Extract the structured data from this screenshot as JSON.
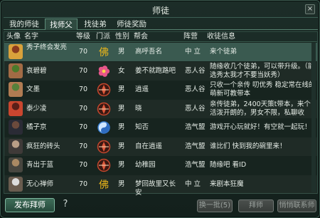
{
  "window": {
    "title": "师徒",
    "close_label": "×"
  },
  "tabs": [
    {
      "label": "我的师徒"
    },
    {
      "label": "找师父"
    },
    {
      "label": "找徒弟"
    },
    {
      "label": "师徒奖励"
    }
  ],
  "active_tab": 1,
  "columns": [
    "头像",
    "名字",
    "等级",
    "门派",
    "性别",
    "帮会",
    "阵营",
    "收徒信息"
  ],
  "rows": [
    {
      "name": "秀子终会发亮",
      "level": "70",
      "sect_icon": "fo-sect-icon",
      "gender": "男",
      "guild": "高呼吾名",
      "faction": "中 立",
      "info": "来个徒弟"
    },
    {
      "name": "哀碧碧",
      "level": "70",
      "sect_icon": "flower-sect-icon",
      "gender": "女",
      "guild": "姜不就跑路吧",
      "faction": "恶人谷",
      "info": "随缘收几个徒弟，可以带升级。（能选秀太我才不要当妖秀）"
    },
    {
      "name": "文墨",
      "level": "70",
      "sect_icon": "sword-sect-icon",
      "gender": "男",
      "guild": "逍遥",
      "faction": "恶人谷",
      "info": "只收一个亲传 叨优秀 稳定常在线的 萌新可教带本"
    },
    {
      "name": "泰少凌",
      "level": "70",
      "sect_icon": "sword-sect-icon",
      "gender": "男",
      "guild": "晓",
      "faction": "恶人谷",
      "info": "亲传徒弟，2400天策t带本，来个活泼开朗的，男女不限，私聊收"
    },
    {
      "name": "橘子京",
      "level": "70",
      "sect_icon": "taiji-sect-icon",
      "gender": "男",
      "guild": "知否",
      "faction": "浩气盟",
      "info": "游戏开心玩就好！有空就一起玩！"
    },
    {
      "name": "疯狂的砖头",
      "level": "70",
      "sect_icon": "sword-sect-icon",
      "gender": "男",
      "guild": "自在逍遥",
      "faction": "浩气盟",
      "info": "谁比们 快到我的碗里来！"
    },
    {
      "name": "青出于蓝",
      "level": "70",
      "sect_icon": "sword-sect-icon",
      "gender": "男",
      "guild": "幼稚园",
      "faction": "浩气盟",
      "info": "随缘吧 看ID"
    },
    {
      "name": "无心禅师",
      "level": "70",
      "sect_icon": "fo-sect-icon",
      "gender": "男",
      "guild": "梦回故里又长安",
      "faction": "中 立",
      "info": "来剧本狂魔"
    }
  ],
  "selected_row": 0,
  "bottom": {
    "publish_label": "发布拜师",
    "help_label": "?",
    "refresh_label": "换一批(5)",
    "apprentice_label": "拜师",
    "contact_label": "悄悄联系师"
  },
  "colors": {
    "accent": "#3a5a50",
    "sect_gold": "#e9b51a",
    "sect_red": "#c4472d"
  }
}
